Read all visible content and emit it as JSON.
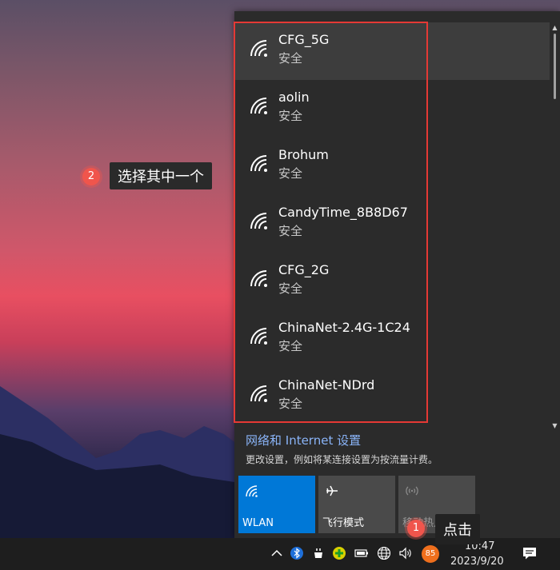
{
  "wifi_networks": [
    {
      "name": "CFG_5G",
      "status": "安全"
    },
    {
      "name": "aolin",
      "status": "安全"
    },
    {
      "name": "Brohum",
      "status": "安全"
    },
    {
      "name": "CandyTime_8B8D67",
      "status": "安全"
    },
    {
      "name": "CFG_2G",
      "status": "安全"
    },
    {
      "name": "ChinaNet-2.4G-1C24",
      "status": "安全"
    },
    {
      "name": "ChinaNet-NDrd",
      "status": "安全"
    }
  ],
  "settings": {
    "title": "网络和 Internet 设置",
    "description": "更改设置，例如将某连接设置为按流量计费。"
  },
  "quick_actions": {
    "wlan_label": "WLAN",
    "airplane_label": "飞行模式",
    "hotspot_label": "移动热点"
  },
  "annotations": {
    "step1_number": "1",
    "step1_text": "点击",
    "step2_number": "2",
    "step2_text": "选择其中一个"
  },
  "taskbar": {
    "time": "10:47",
    "date": "2023/9/20",
    "badge_count": "85"
  },
  "colors": {
    "accent": "#0078d7",
    "annotation_red": "#e53935",
    "badge_red": "#f0554c",
    "link_blue": "#8ab4f8"
  }
}
